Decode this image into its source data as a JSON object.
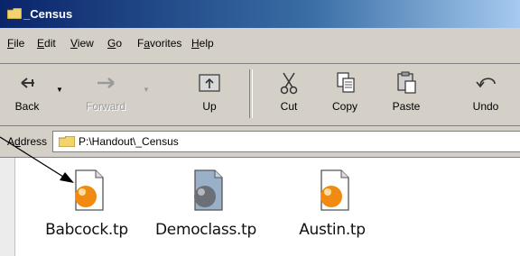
{
  "window": {
    "title": "_Census"
  },
  "menu": {
    "items": [
      {
        "label": "File",
        "accel": "F"
      },
      {
        "label": "Edit",
        "accel": "E"
      },
      {
        "label": "View",
        "accel": "V"
      },
      {
        "label": "Go",
        "accel": "G"
      },
      {
        "label": "Favorites",
        "accel": "a"
      },
      {
        "label": "Help",
        "accel": "H"
      }
    ]
  },
  "toolbar": {
    "back": "Back",
    "forward": "Forward",
    "up": "Up",
    "cut": "Cut",
    "copy": "Copy",
    "paste": "Paste",
    "undo": "Undo"
  },
  "address": {
    "label": "Address",
    "path": "P:\\Handout\\_Census"
  },
  "files": [
    {
      "name": "Babcock.tp",
      "icon": "orange-disc-file-icon"
    },
    {
      "name": "Democlass.tp",
      "icon": "blue-disc-file-icon"
    },
    {
      "name": "Austin.tp",
      "icon": "orange-disc-file-icon"
    }
  ],
  "colors": {
    "titlebar": "#0a246a",
    "chrome": "#d4d0c8"
  }
}
